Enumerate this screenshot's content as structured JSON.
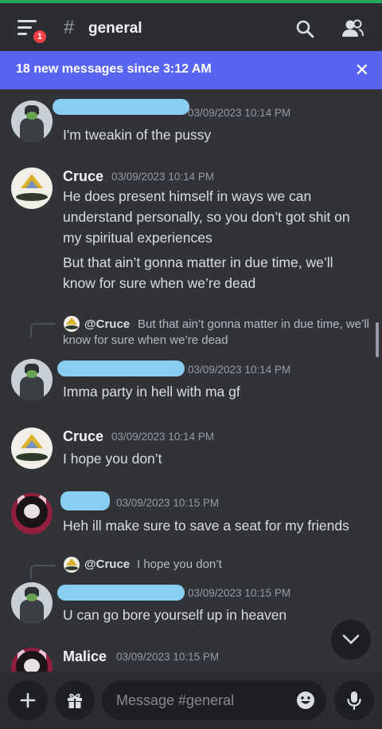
{
  "header": {
    "notification_count": "1",
    "hash": "#",
    "channel_name": "general",
    "icons": [
      "menu-icon",
      "search-icon",
      "members-icon"
    ]
  },
  "new_messages_bar": {
    "text": "18 new messages since 3:12 AM",
    "close": "✕"
  },
  "messages": [
    {
      "author": "",
      "author_redacted": true,
      "timestamp": "03/09/2023 10:14 PM",
      "lines": [
        "I'm tweakin of the pussy"
      ]
    },
    {
      "author": "Cruce",
      "timestamp": "03/09/2023 10:14 PM",
      "lines": [
        "He does present himself in ways we can understand personally, so you don’t got shit on my spiritual experiences",
        "But that ain’t gonna matter in due time, we’ll know for sure when we’re dead"
      ]
    },
    {
      "reply_to": "@Cruce",
      "reply_text": "But that ain’t gonna matter in due time, we’ll know for sure when we’re dead",
      "author": "",
      "author_redacted": true,
      "timestamp": "03/09/2023 10:14 PM",
      "lines": [
        "Imma party in hell with ma gf"
      ]
    },
    {
      "author": "Cruce",
      "timestamp": "03/09/2023 10:14 PM",
      "lines": [
        "I hope you don’t"
      ]
    },
    {
      "author": "",
      "author_redacted": true,
      "timestamp": "03/09/2023 10:15 PM",
      "lines": [
        "Heh ill make sure to save a seat for my friends"
      ]
    },
    {
      "reply_to": "@Cruce",
      "reply_text": "I hope you don’t",
      "author": "",
      "author_redacted": true,
      "timestamp": "03/09/2023 10:15 PM",
      "lines": [
        "U can go bore yourself up in heaven"
      ]
    },
    {
      "author": "Malice",
      "timestamp": "03/09/2023 10:15 PM",
      "lines": []
    }
  ],
  "composer": {
    "placeholder": "Message #general",
    "icons": [
      "plus-icon",
      "gift-icon",
      "emoji-icon",
      "microphone-icon"
    ]
  },
  "colors": {
    "background": "#313338",
    "header": "#2b2d31",
    "accent": "#5865f2",
    "redaction": "#87cef2",
    "badge": "#f23f43"
  }
}
